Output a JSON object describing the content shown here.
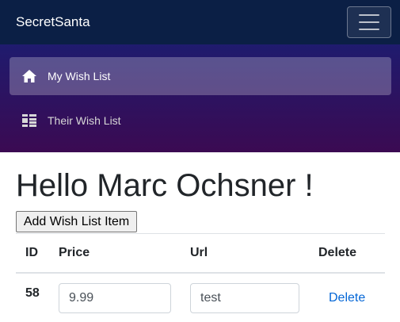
{
  "navbar": {
    "brand": "SecretSanta",
    "toggler_icon": "hamburger-icon"
  },
  "sidebar": {
    "items": [
      {
        "label": "My Wish List",
        "icon": "home-icon",
        "active": true
      },
      {
        "label": "Their Wish List",
        "icon": "list-icon",
        "active": false
      }
    ]
  },
  "main": {
    "greeting": "Hello Marc Ochsner !",
    "add_button_label": "Add Wish List Item",
    "table": {
      "headers": [
        "ID",
        "Price",
        "Url",
        "Delete"
      ],
      "rows": [
        {
          "id": "58",
          "price": "9.99",
          "url": "test",
          "delete_label": "Delete"
        }
      ]
    }
  },
  "colors": {
    "navbar_bg": "#0b1f45",
    "sidebar_gradient_top": "#1f1b6e",
    "sidebar_gradient_bottom": "#3b0a52",
    "link": "#0366d6"
  }
}
